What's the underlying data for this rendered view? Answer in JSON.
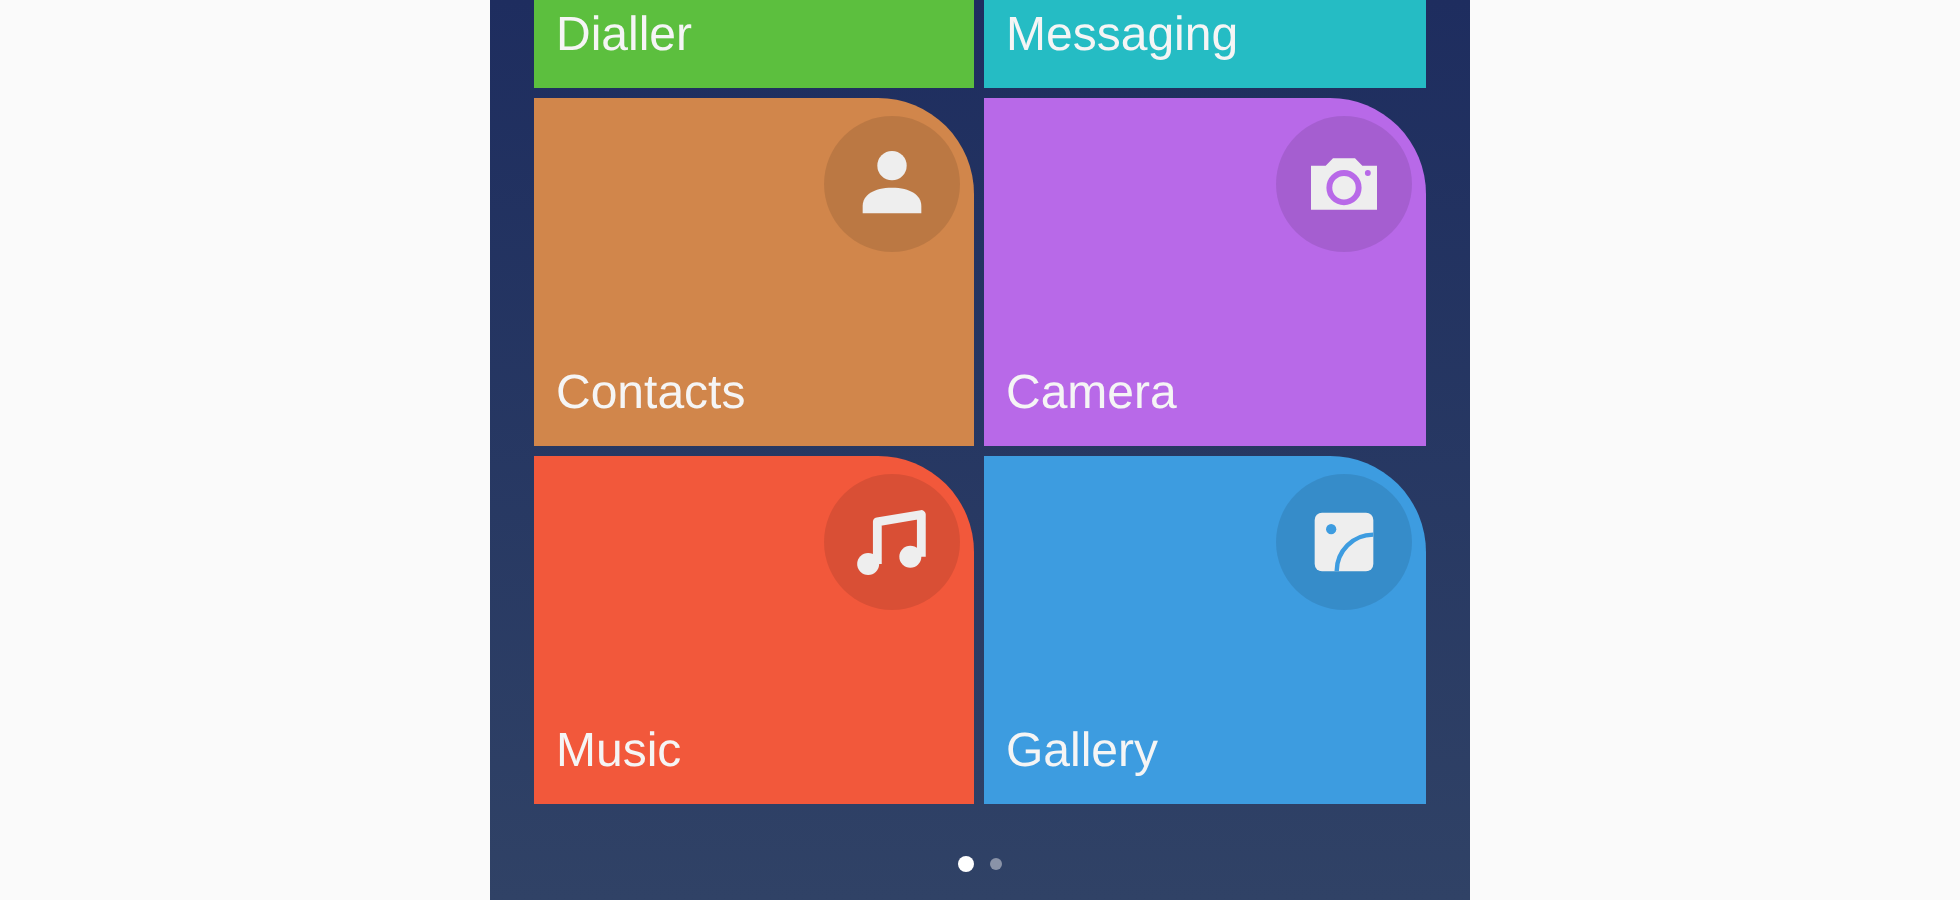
{
  "tiles": [
    {
      "label": "Dialler",
      "color": "#5cbf3e",
      "kind": "plain"
    },
    {
      "label": "Messaging",
      "color": "#25bcc4",
      "kind": "plain"
    },
    {
      "label": "Contacts",
      "color": "#d1864b",
      "kind": "person"
    },
    {
      "label": "Camera",
      "color": "#b869e8",
      "kind": "camera"
    },
    {
      "label": "Music",
      "color": "#f2583b",
      "kind": "music"
    },
    {
      "label": "Gallery",
      "color": "#3d9ce0",
      "kind": "image"
    }
  ],
  "page_dots": [
    {
      "selected": true
    },
    {
      "selected": false
    }
  ]
}
